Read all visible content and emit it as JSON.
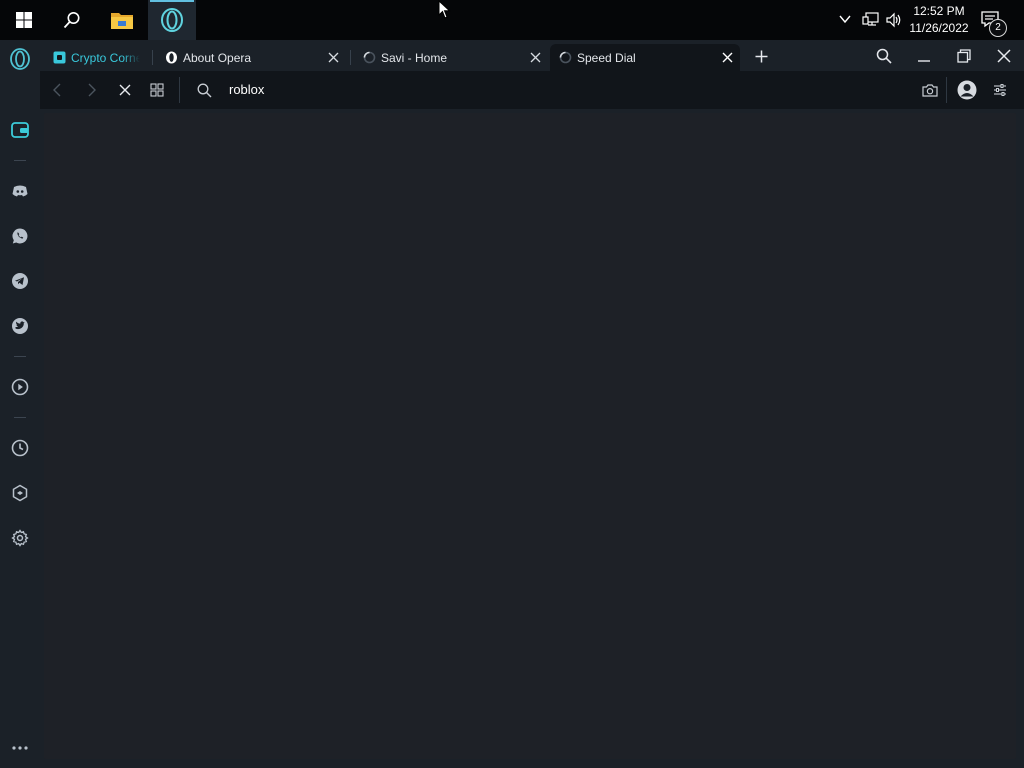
{
  "taskbar": {
    "icons": [
      "windows-start-icon",
      "search-icon",
      "file-explorer-icon",
      "opera-gx-icon"
    ],
    "clock": {
      "time": "12:52 PM",
      "date": "11/26/2022"
    },
    "notification_count": "2"
  },
  "sidebar": {
    "items": [
      "crypto-wallet-icon",
      "discord-icon",
      "whatsapp-icon",
      "telegram-icon",
      "twitter-icon",
      "player-icon",
      "history-icon",
      "extensions-icon",
      "settings-icon",
      "more-icon"
    ]
  },
  "tabs": [
    {
      "title": "Crypto Corner",
      "favicon": "crypto-wallet-icon",
      "active": false
    },
    {
      "title": "About Opera",
      "favicon": "opera-icon",
      "active": false
    },
    {
      "title": "Savi - Home",
      "favicon": "loading-spinner-icon",
      "active": false
    },
    {
      "title": "Speed Dial",
      "favicon": "loading-spinner-icon",
      "active": true
    }
  ],
  "address_bar": {
    "value": "roblox"
  },
  "colors": {
    "accent": "#39c8db",
    "frame": "#1b2128",
    "toolbar": "#11151a",
    "content": "#1e2127"
  }
}
